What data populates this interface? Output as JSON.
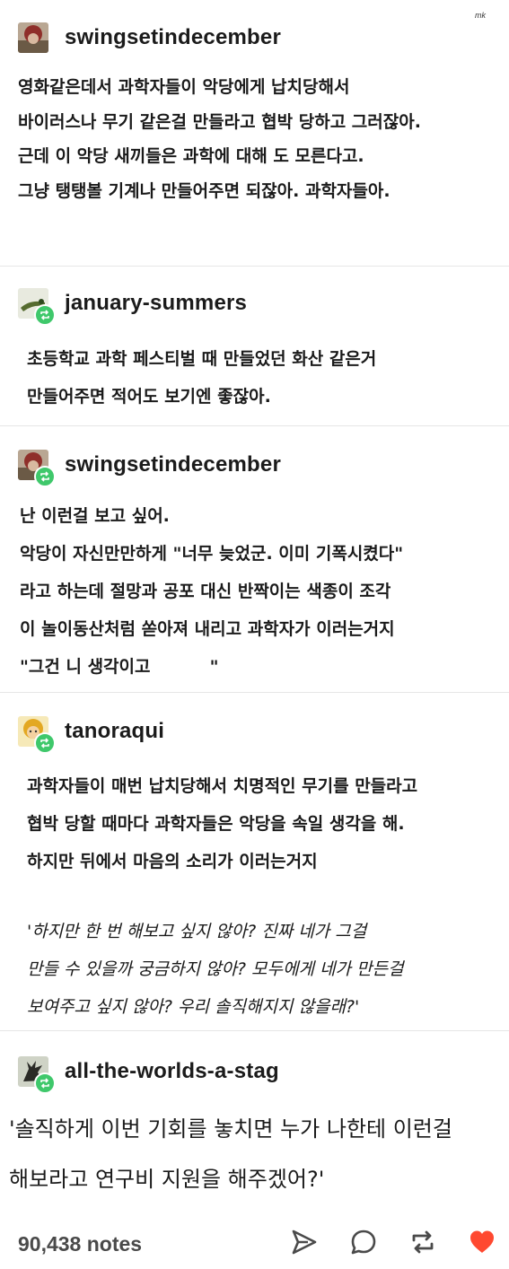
{
  "watermark": "mk",
  "posts": [
    {
      "username": "swingsetindecember",
      "reblog": false,
      "lines": [
        "영화같은데서 과학자들이 악당에게 납치당해서",
        "바이러스나 무기 같은걸 만들라고 협박 당하고 그러잖아.",
        "근데 이 악당 새끼들은 과학에 대해     도 모른다고.",
        "그냥 탱탱볼 기계나 만들어주면 되잖아. 과학자들아."
      ]
    },
    {
      "username": "january-summers",
      "reblog": true,
      "lines": [
        "초등학교 과학 페스티벌 때 만들었던 화산 같은거",
        "만들어주면 적어도 보기엔 좋잖아."
      ]
    },
    {
      "username": "swingsetindecember",
      "reblog": true,
      "lines": [
        "난 이런걸 보고 싶어.",
        "악당이 자신만만하게 \"너무 늦었군. 이미 기폭시켰다\"",
        "라고 하는데 절망과 공포 대신 반짝이는 색종이 조각",
        "이 놀이동산처럼 쏟아져 내리고 과학자가 이러는거지",
        "\"그건 니 생각이고          \""
      ]
    },
    {
      "username": "tanoraqui",
      "reblog": true,
      "lines": [
        "과학자들이 매번 납치당해서 치명적인 무기를 만들라고",
        "협박 당할 때마다 과학자들은 악당을 속일 생각을 해.",
        "하지만 뒤에서 마음의 소리가 이러는거지"
      ],
      "quote_lines": [
        "'하지만 한 번 해보고 싶지 않아? 진짜 네가 그걸",
        "만들 수 있을까 궁금하지 않아? 모두에게 네가 만든걸",
        "보여주고 싶지 않아? 우리 솔직해지지 않을래?'"
      ]
    },
    {
      "username": "all-the-worlds-a-stag",
      "reblog": true,
      "lines": [
        "'솔직하게 이번 기회를 놓치면 누가 나한테 이런걸",
        "해보라고 연구비 지원을 해주겠어?'"
      ]
    }
  ],
  "footer": {
    "notes": "90,438 notes",
    "icons": [
      "send-icon",
      "reply-icon",
      "reblog-icon",
      "heart-icon"
    ],
    "heart_color": "#ff4930",
    "icon_color": "#4a4a4a"
  },
  "colors": {
    "reblog_badge": "#3fc86b"
  }
}
